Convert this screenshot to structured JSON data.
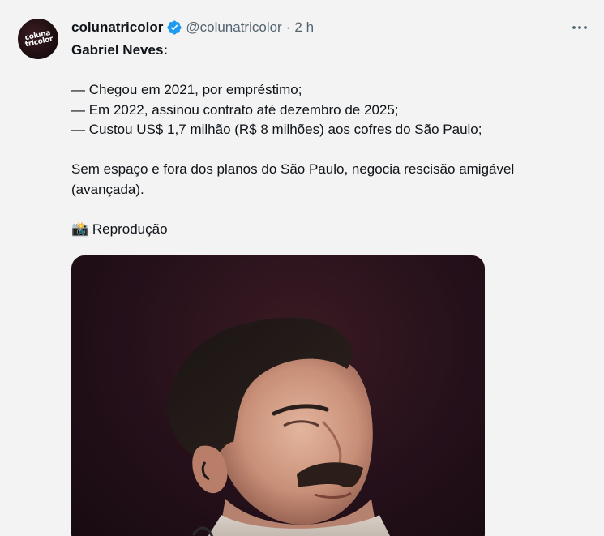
{
  "account": {
    "avatar_text_line1": "coluna",
    "avatar_text_line2": "tricolor",
    "display_name": "colunatricolor",
    "handle": "@colunatricolor",
    "separator": "·",
    "time": "2 h",
    "verified_color": "#1d9bf0"
  },
  "tweet": {
    "line_title": "Gabriel Neves:",
    "line_1": "— Chegou em 2021, por empréstimo;",
    "line_2": "— Em 2022, assinou contrato até dezembro de 2025;",
    "line_3": "— Custou US$ 1,7 milhão (R$ 8 milhões) aos cofres do São Paulo;",
    "line_4": "Sem espaço e fora dos planos do São Paulo, negocia rescisão amigável",
    "line_5": "(avançada).",
    "credit_emoji": "📸",
    "credit_text": "Reprodução"
  },
  "icons": {
    "more": "more-icon",
    "verified": "verified-badge-icon",
    "camera": "camera-emoji-icon"
  }
}
